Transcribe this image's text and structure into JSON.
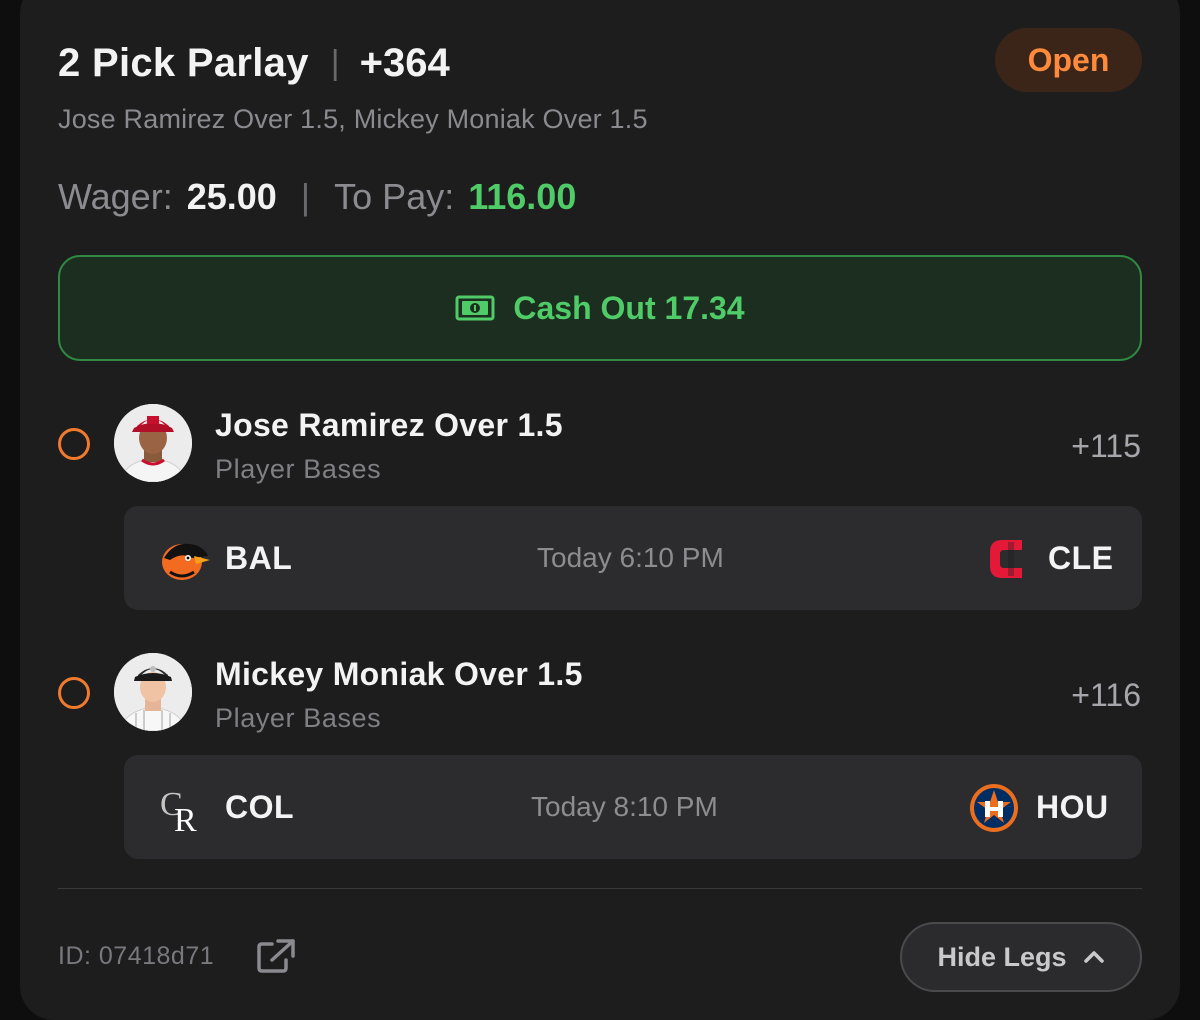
{
  "bet": {
    "title": "2 Pick Parlay",
    "title_separator": "|",
    "odds": "+364",
    "status": "Open",
    "subtitle": "Jose Ramirez Over 1.5, Mickey Moniak Over 1.5"
  },
  "wager": {
    "wager_label": "Wager:",
    "wager_value": "25.00",
    "separator": "|",
    "topay_label": "To Pay:",
    "topay_value": "116.00"
  },
  "cashout": {
    "label": "Cash Out 17.34",
    "icon": "cash-icon"
  },
  "legs": [
    {
      "title": "Jose Ramirez Over 1.5",
      "market": "Player Bases",
      "odds": "+115",
      "away": {
        "abbr": "BAL",
        "logo": "orioles-logo",
        "color": "#f26b21"
      },
      "time": "Today 6:10 PM",
      "home": {
        "abbr": "CLE",
        "logo": "guardians-logo",
        "color": "#e31937"
      }
    },
    {
      "title": "Mickey Moniak Over 1.5",
      "market": "Player Bases",
      "odds": "+116",
      "away": {
        "abbr": "COL",
        "logo": "rockies-logo",
        "color": "#ffffff"
      },
      "time": "Today 8:10 PM",
      "home": {
        "abbr": "HOU",
        "logo": "astros-logo",
        "color": "#eb6e1f"
      }
    }
  ],
  "footer": {
    "id_text": "ID: 07418d71",
    "share_icon": "share-icon",
    "hide_legs_label": "Hide Legs",
    "chevron_icon": "chevron-up-icon"
  },
  "colors": {
    "accent_orange": "#ff8a3c",
    "accent_green": "#4fcb68",
    "card_bg": "#1d1d1e"
  }
}
